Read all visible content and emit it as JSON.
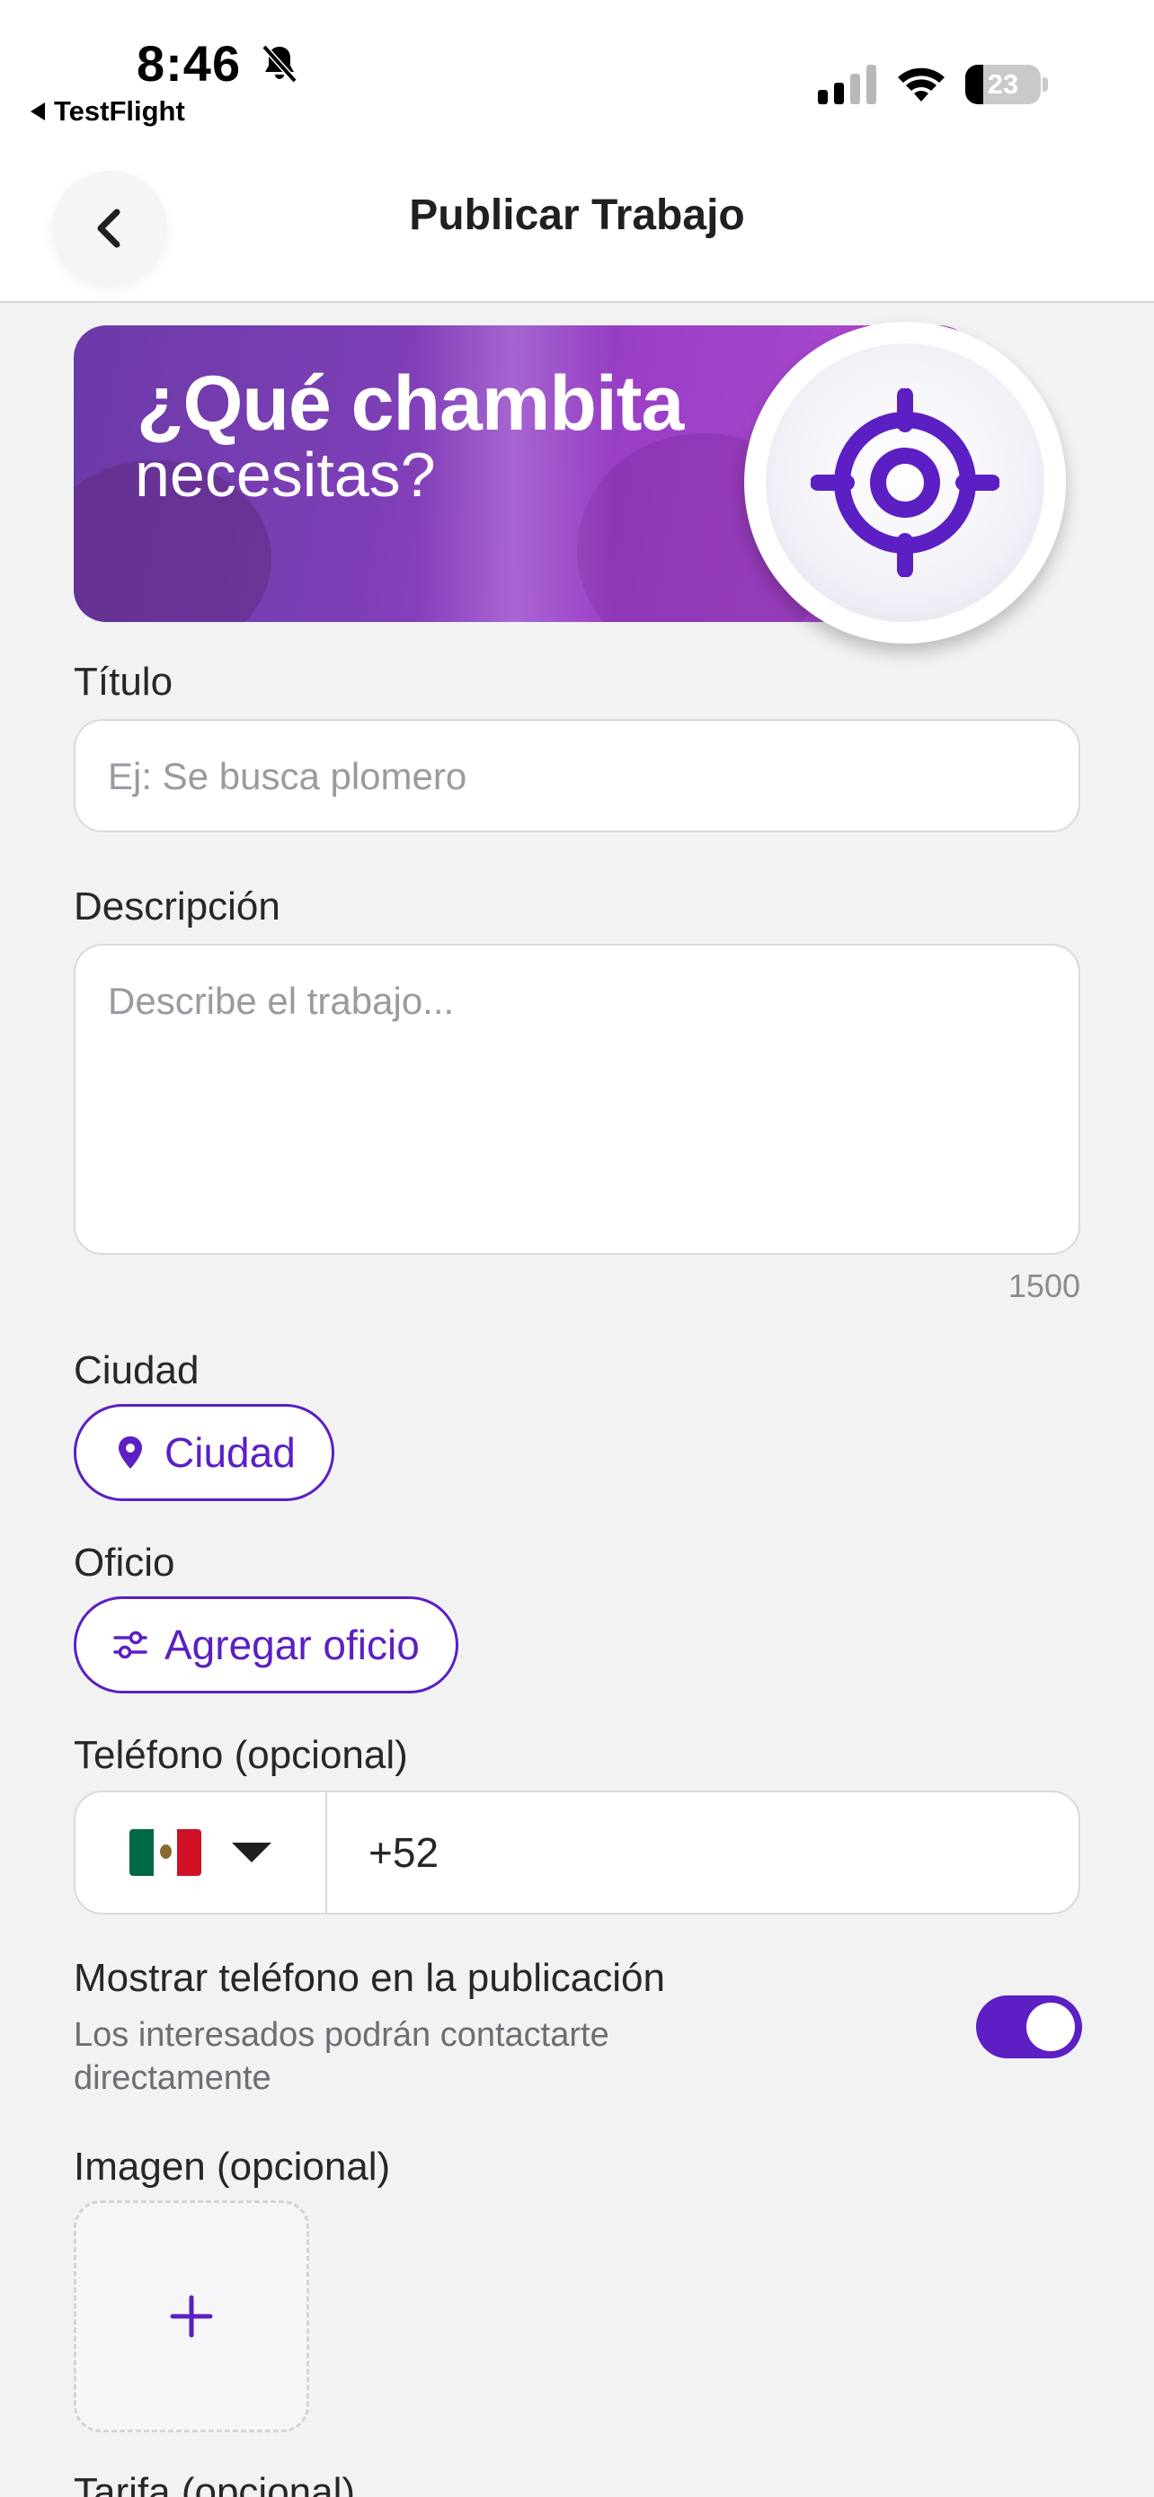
{
  "status_bar": {
    "time": "8:46",
    "back_app": "TestFlight",
    "battery_level": "23",
    "icons": [
      "bell-muted-icon",
      "cellular-signal-icon",
      "wifi-icon",
      "battery-icon"
    ]
  },
  "header": {
    "title": "Publicar Trabajo",
    "back_icon": "chevron-left-icon"
  },
  "banner": {
    "line1": "¿Qué chambita",
    "line2": "necesitas?",
    "icon": "crosshair-target-icon"
  },
  "form": {
    "titulo": {
      "label": "Título",
      "placeholder": "Ej: Se busca plomero",
      "value": ""
    },
    "descripcion": {
      "label": "Descripción",
      "placeholder": "Describe el trabajo...",
      "counter": "1500",
      "value": ""
    },
    "ciudad": {
      "label": "Ciudad",
      "button": "Ciudad",
      "icon": "map-pin-icon"
    },
    "oficio": {
      "label": "Oficio",
      "button": "Agregar oficio",
      "icon": "sliders-icon"
    },
    "telefono": {
      "label": "Teléfono (opcional)",
      "country_flag": "mexico-flag-icon",
      "prefix": "+52"
    },
    "mostrar_telefono": {
      "title": "Mostrar teléfono en la publicación",
      "subtitle": "Los interesados podrán contactarte directamente",
      "enabled": true
    },
    "imagen": {
      "label": "Imagen (opcional)",
      "add_icon": "plus-icon"
    },
    "tarifa": {
      "label": "Tarifa (opcional)"
    }
  },
  "colors": {
    "accent": "#5b1fc4",
    "background": "#f2f2f3",
    "banner_gradient": [
      "#6b3aa8",
      "#b24ed2"
    ]
  }
}
